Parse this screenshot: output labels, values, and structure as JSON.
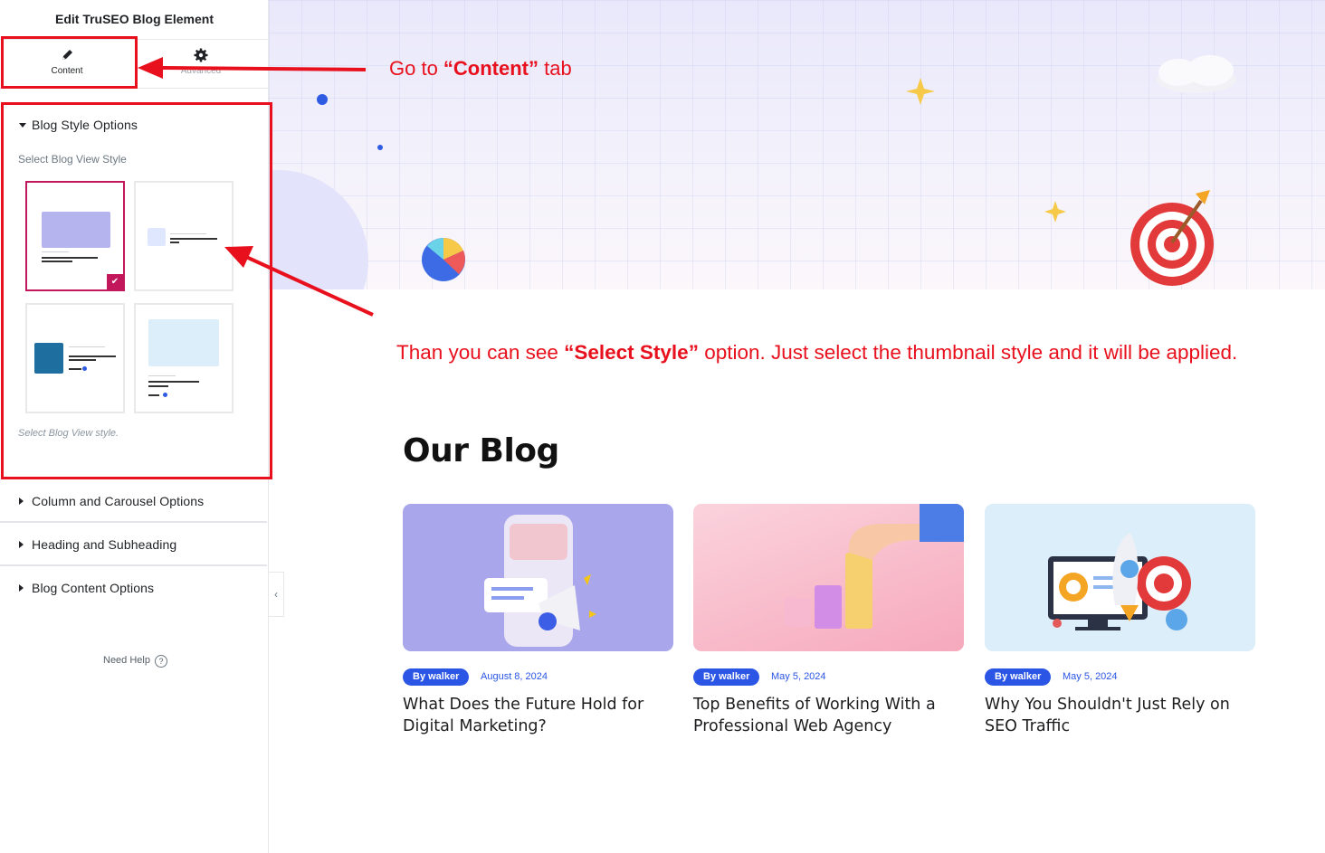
{
  "panel": {
    "title": "Edit TruSEO Blog Element",
    "tabs": [
      {
        "label": "Content",
        "icon": "pencil-icon"
      },
      {
        "label": "Advanced",
        "icon": "gear-icon"
      }
    ],
    "sections": [
      {
        "label": "Blog Style Options",
        "expanded": true
      },
      {
        "label": "Column and Carousel Options",
        "expanded": false
      },
      {
        "label": "Heading and Subheading",
        "expanded": false
      },
      {
        "label": "Blog Content Options",
        "expanded": false
      }
    ],
    "style_field": {
      "label": "Select Blog View Style",
      "description": "Select Blog View style.",
      "selected_index": 0,
      "thumbnails": [
        {
          "style": "image-top"
        },
        {
          "style": "image-left-small"
        },
        {
          "style": "image-left-large"
        },
        {
          "style": "image-top-alt"
        }
      ]
    },
    "need_help": "Need Help",
    "help_icon": "?"
  },
  "annotations": {
    "tab_hint_prefix": "Go  to ",
    "tab_hint_bold": "“Content”",
    "tab_hint_suffix": " tab",
    "style_hint_prefix": "Than you can see ",
    "style_hint_bold": "“Select Style”",
    "style_hint_suffix": " option. Just select the thumbnail style and it will be applied.",
    "color": "#e8101c"
  },
  "preview": {
    "heading": "Our Blog",
    "posts": [
      {
        "author": "By walker",
        "date": "August 8, 2024",
        "title": "What Does the Future Hold for Digital Marketing?",
        "image": "phone-megaphone-illustration"
      },
      {
        "author": "By walker",
        "date": "May 5, 2024",
        "title": "Top Benefits of Working With a Professional Web Agency",
        "image": "hand-bar-chart-illustration"
      },
      {
        "author": "By walker",
        "date": "May 5, 2024",
        "title": "Why You Shouldn't Just Rely on SEO Traffic",
        "image": "monitor-rocket-target-illustration"
      }
    ],
    "accent": "#2a55e5"
  }
}
